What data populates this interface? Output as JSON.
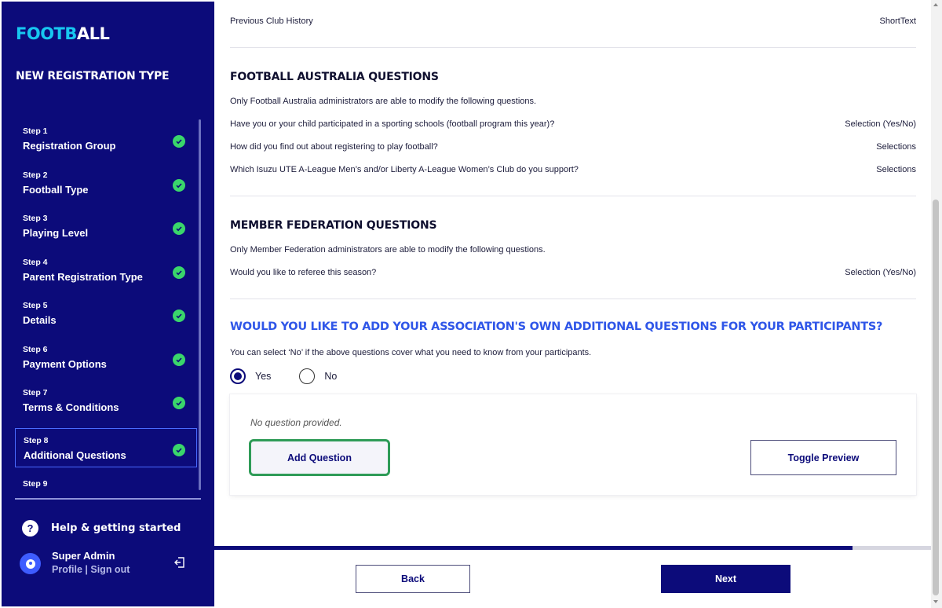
{
  "sidebar": {
    "logo_part1": "FOOTB",
    "logo_part2": "ALL",
    "title": "NEW REGISTRATION TYPE",
    "steps": [
      {
        "num": "Step 1",
        "label": "Registration Group",
        "status": "complete"
      },
      {
        "num": "Step 2",
        "label": "Football Type",
        "status": "complete"
      },
      {
        "num": "Step 3",
        "label": "Playing Level",
        "status": "complete"
      },
      {
        "num": "Step 4",
        "label": "Parent Registration Type",
        "status": "complete"
      },
      {
        "num": "Step 5",
        "label": "Details",
        "status": "complete"
      },
      {
        "num": "Step 6",
        "label": "Payment Options",
        "status": "complete"
      },
      {
        "num": "Step 7",
        "label": "Terms & Conditions",
        "status": "complete"
      },
      {
        "num": "Step 8",
        "label": "Additional Questions",
        "status": "complete",
        "active": true
      },
      {
        "num": "Step 9",
        "label": "",
        "status": ""
      }
    ],
    "help_label": "Help & getting started",
    "user_name": "Super Admin",
    "profile_link": "Profile",
    "link_separator": "|",
    "signout_link": "Sign out"
  },
  "main": {
    "previous_row": {
      "question": "Previous Club History",
      "type": "ShortText"
    },
    "fa_section": {
      "title": "FOOTBALL AUSTRALIA QUESTIONS",
      "desc": "Only Football Australia administrators are able to modify the following questions.",
      "rows": [
        {
          "question": "Have you or your child participated in a sporting schools (football program this year)?",
          "type": "Selection (Yes/No)"
        },
        {
          "question": "How did you find out about registering to play football?",
          "type": "Selections"
        },
        {
          "question": "Which Isuzu UTE A-League Men’s and/or Liberty A-League Women’s Club do you support?",
          "type": "Selections"
        }
      ]
    },
    "mf_section": {
      "title": "MEMBER FEDERATION QUESTIONS",
      "desc": "Only Member Federation administrators are able to modify the following questions.",
      "rows": [
        {
          "question": "Would you like to referee this season?",
          "type": "Selection (Yes/No)"
        }
      ]
    },
    "additional": {
      "title": "WOULD YOU LIKE TO ADD YOUR ASSOCIATION'S OWN ADDITIONAL QUESTIONS FOR YOUR PARTICIPANTS?",
      "desc": "You can select ‘No’ if the above questions cover what you need to know from your participants.",
      "option_yes": "Yes",
      "option_no": "No",
      "selected": "Yes",
      "empty_text": "No question provided.",
      "add_button": "Add Question",
      "toggle_button": "Toggle Preview"
    },
    "progress_fraction": 0.89,
    "back_button": "Back",
    "next_button": "Next"
  },
  "colors": {
    "sidebar_bg": "#0c0b7a",
    "logo_accent": "#17c7f0",
    "accent_blue": "#2f56e8",
    "check_green": "#3ad66b",
    "focus_green": "#2e9b57"
  }
}
